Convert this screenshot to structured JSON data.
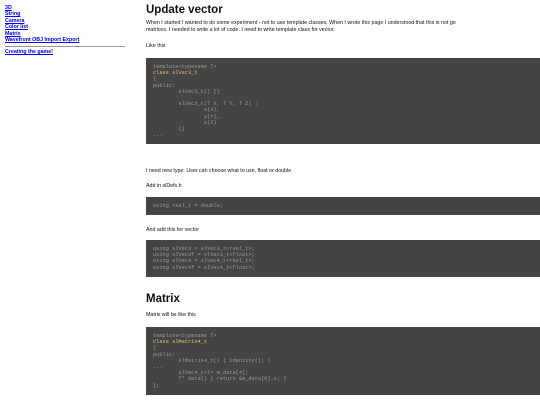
{
  "sidebar": {
    "links": [
      "3D",
      "String",
      "Camera",
      "Color list",
      "Matrix",
      "Wavefront OBJ Import Export"
    ],
    "creating_game": "Creating the game!"
  },
  "main": {
    "title_update": "Update vector",
    "intro_line1": "When I started I wanted to do some experiment - not to use template classes. When I wrote this page I understood that this is not go",
    "intro_line2": "matrices. I needed to write a lot of code. I need to write template class for vector.",
    "like_this": "Like this",
    "code1": [
      "template<typename T>",
      "class slVec3_t",
      "{",
      "public:",
      "        slVec3_t() {}",
      "",
      "        slVec3_t(T X, T Y, T Z) :",
      "                x(X),",
      "                y(Y),",
      "                z(Z)",
      "        {}",
      "..."
    ],
    "need_new_type": "I need new type. User can choose what to use, float or double",
    "add_in_defs": "Add in slDefs.h",
    "code2": [
      "using real_t = double;"
    ],
    "add_this": "And add this for vector",
    "code3": [
      "using slVec3 = slVec3_t<real_t>;",
      "using slVec3f = slVec3_t<float>;",
      "using slVec4 = slVec4_t<real_t>;",
      "using slVec4f = slVec4_t<float>;"
    ],
    "title_matrix": "Matrix",
    "matrix_like": "Matrix will be like this",
    "code4": [
      "template<typename T>",
      "class slMatrix4_t",
      "{",
      "public:",
      "        slMatrix4_t() { identity(); }",
      "...",
      "        slVec4_t<T> m_data[4];",
      "        T* data() { return &m_data[0].x; }",
      "};"
    ]
  }
}
